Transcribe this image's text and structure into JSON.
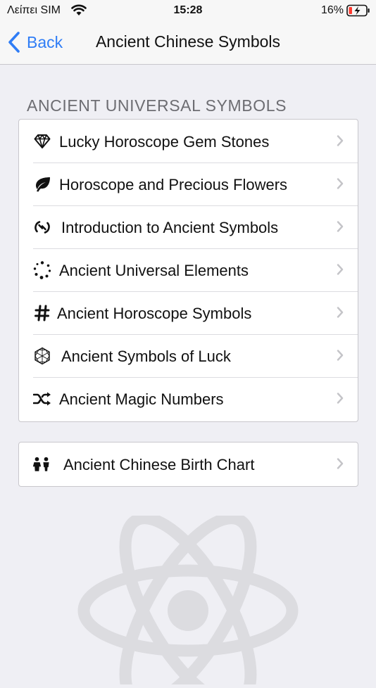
{
  "status_bar": {
    "carrier": "Λείπει SIM",
    "time": "15:28",
    "battery_percent": "16%",
    "wifi_icon": "wifi-icon",
    "battery_icon": "battery-charging-icon",
    "battery_color": "#ff3b30"
  },
  "nav": {
    "back_label": "Back",
    "title": "Ancient Chinese Symbols",
    "accent": "#2f7df6"
  },
  "section": {
    "header": "ANCIENT UNIVERSAL SYMBOLS",
    "items": [
      {
        "label": "Lucky Horoscope Gem Stones",
        "icon": "diamond-icon"
      },
      {
        "label": "Horoscope and Precious Flowers",
        "icon": "leaf-icon"
      },
      {
        "label": "Introduction to Ancient Symbols",
        "icon": "no-link-icon"
      },
      {
        "label": "Ancient Universal Elements",
        "icon": "dotted-circle-icon"
      },
      {
        "label": "Ancient Horoscope Symbols",
        "icon": "hashtag-icon"
      },
      {
        "label": "Ancient Symbols of Luck",
        "icon": "hexagon-icon"
      },
      {
        "label": "Ancient Magic Numbers",
        "icon": "shuffle-icon"
      }
    ]
  },
  "section2": {
    "items": [
      {
        "label": "Ancient Chinese Birth Chart",
        "icon": "children-icon"
      }
    ]
  },
  "watermark": {
    "icon": "atom-icon"
  }
}
